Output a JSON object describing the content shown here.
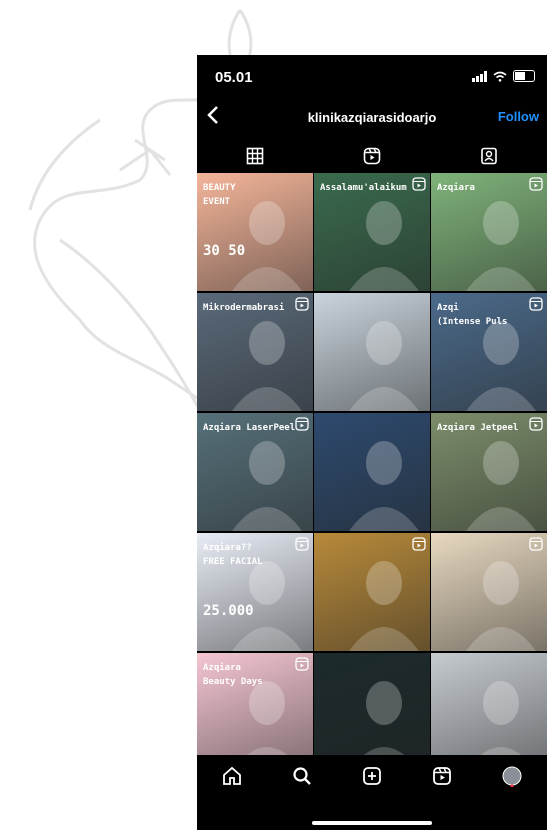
{
  "status": {
    "time": "05.01"
  },
  "header": {
    "username": "klinikazqiarasidoarjo",
    "follow": "Follow"
  },
  "tabs": [
    "grid-icon",
    "reels-icon",
    "tagged-icon"
  ],
  "grid": [
    {
      "bg": "#f4b59a",
      "cap1": "BEAUTY",
      "cap2": "EVENT",
      "promo": "30 50"
    },
    {
      "bg": "#3a6b4d",
      "cap1": "Assalamu'alaikum",
      "cap2": "",
      "promo": ""
    },
    {
      "bg": "#7fb37a",
      "cap1": "Azqiara",
      "cap2": "",
      "promo": ""
    },
    {
      "bg": "#5a6a7a",
      "cap1": "Mikrodermabrasi",
      "cap2": "",
      "promo": ""
    },
    {
      "bg": "#c9d4dc",
      "cap1": "",
      "cap2": "",
      "promo": ""
    },
    {
      "bg": "#4b6a8a",
      "cap1": "Azqi",
      "cap2": "(Intense Puls",
      "promo": ""
    },
    {
      "bg": "#56707a",
      "cap1": "Azqiara LaserPeel",
      "cap2": "",
      "promo": ""
    },
    {
      "bg": "#2d4a6e",
      "cap1": "",
      "cap2": "",
      "promo": ""
    },
    {
      "bg": "#7c8e6b",
      "cap1": "Azqiara Jetpeel",
      "cap2": "",
      "promo": ""
    },
    {
      "bg": "#e8ecf5",
      "cap1": "Azqiara??",
      "cap2": "FREE FACIAL",
      "promo": "25.000"
    },
    {
      "bg": "#b88a3a",
      "cap1": "",
      "cap2": "",
      "promo": ""
    },
    {
      "bg": "#e8d9c0",
      "cap1": "",
      "cap2": "",
      "promo": ""
    },
    {
      "bg": "#f4c6d2",
      "cap1": "Azqiara",
      "cap2": "Beauty Days",
      "promo": ""
    },
    {
      "bg": "#1c2a2c",
      "cap1": "",
      "cap2": "",
      "promo": ""
    },
    {
      "bg": "#c6cbd0",
      "cap1": "",
      "cap2": "",
      "promo": ""
    }
  ],
  "bottom_nav": [
    "home-icon",
    "search-icon",
    "create-icon",
    "reels-icon",
    "profile-avatar"
  ]
}
